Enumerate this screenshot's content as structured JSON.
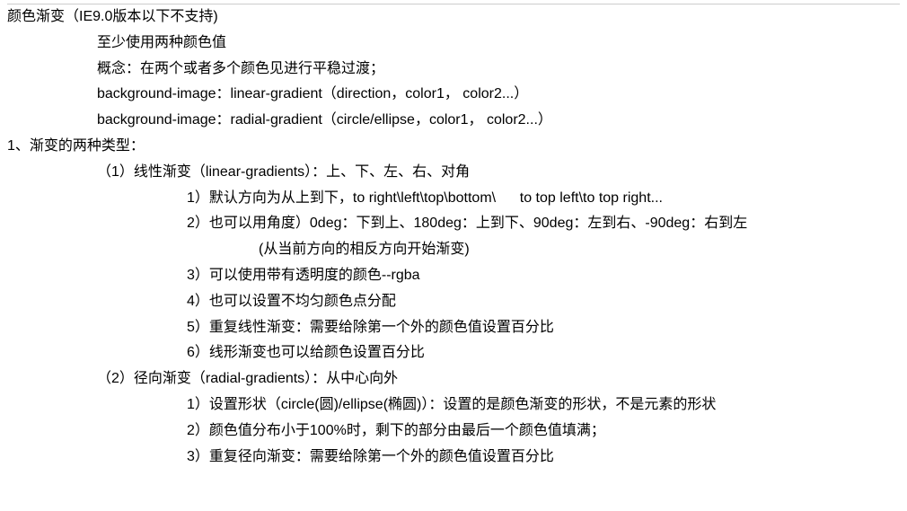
{
  "lines": {
    "title": "颜色渐变（IE9.0版本以下不支持)",
    "l1": "至少使用两种颜色值",
    "l2": "概念：在两个或者多个颜色见进行平稳过渡；",
    "l3": "background-image：linear-gradient（direction，color1， color2...）",
    "l4": "background-image：radial-gradient（circle/ellipse，color1， color2...）",
    "h1": "1、渐变的两种类型：",
    "s1": "（1）线性渐变（linear-gradients）：上、下、左、右、对角",
    "s1_1": "1）默认方向为从上到下，to right\\left\\top\\bottom\\      to top left\\to top right...",
    "s1_2": "2）也可以用角度）0deg：下到上、180deg：上到下、90deg：左到右、-90deg：右到左",
    "s1_2b": "(从当前方向的相反方向开始渐变)",
    "s1_3": "3）可以使用带有透明度的颜色--rgba",
    "s1_4": "4）也可以设置不均匀颜色点分配",
    "s1_5": "5）重复线性渐变：需要给除第一个外的颜色值设置百分比",
    "s1_6": "6）线形渐变也可以给颜色设置百分比",
    "s2": "（2）径向渐变（radial-gradients）：从中心向外",
    "s2_1": "1）设置形状（circle(圆)/ellipse(椭圆)）：设置的是颜色渐变的形状，不是元素的形状",
    "s2_2": "2）颜色值分布小于100%时，剩下的部分由最后一个颜色值填满；",
    "s2_3": "3）重复径向渐变：需要给除第一个外的颜色值设置百分比"
  }
}
